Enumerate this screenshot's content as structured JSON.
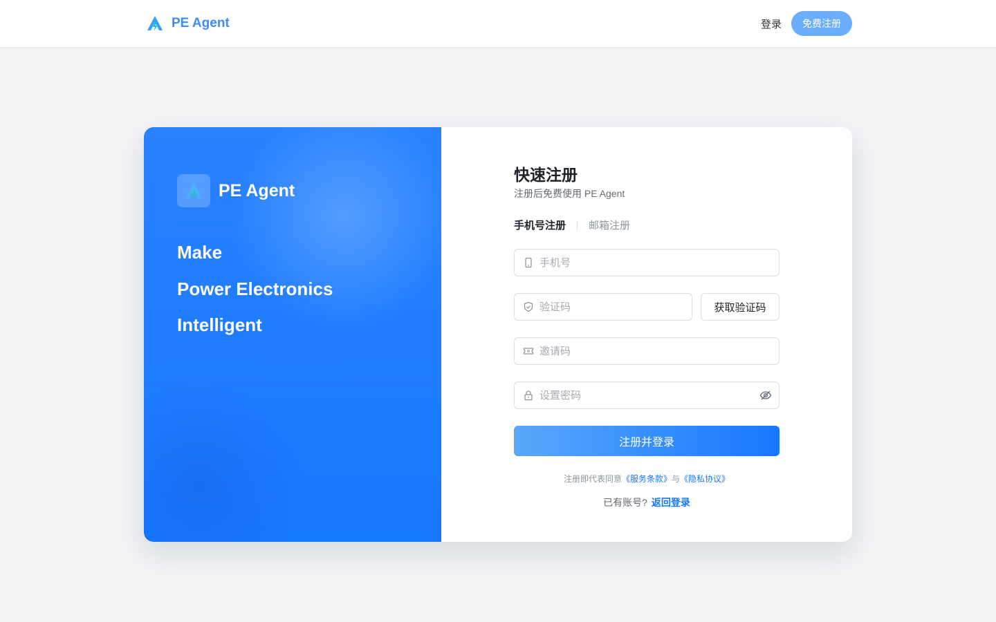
{
  "header": {
    "brand": "PE Agent",
    "login_label": "登录",
    "signup_label": "免费注册"
  },
  "hero": {
    "brand": "PE Agent",
    "slogan": [
      "Make",
      "Power Electronics",
      "Intelligent"
    ]
  },
  "form": {
    "title": "快速注册",
    "subtitle": "注册后免费使用 PE Agent",
    "tabs": [
      {
        "label": "手机号注册",
        "active": true
      },
      {
        "label": "邮箱注册",
        "active": false
      }
    ],
    "phone_placeholder": "手机号",
    "code_placeholder": "验证码",
    "get_code_label": "获取验证码",
    "invite_placeholder": "邀请码",
    "password_placeholder": "设置密码",
    "submit_label": "注册并登录",
    "agree_prefix": "注册即代表同意",
    "terms_link": "《服务条款》",
    "agree_and": "与",
    "privacy_link": "《隐私协议》",
    "has_account": "已有账号?",
    "back_login": "返回登录"
  },
  "colors": {
    "accent": "#1677ff",
    "brand_light": "#3d8bfd",
    "signup_button": "#6aaefc",
    "page_bg": "#f2f3f5"
  },
  "icons": [
    "logo-icon",
    "phone-icon",
    "shield-icon",
    "ticket-icon",
    "lock-icon",
    "eye-off-icon"
  ]
}
